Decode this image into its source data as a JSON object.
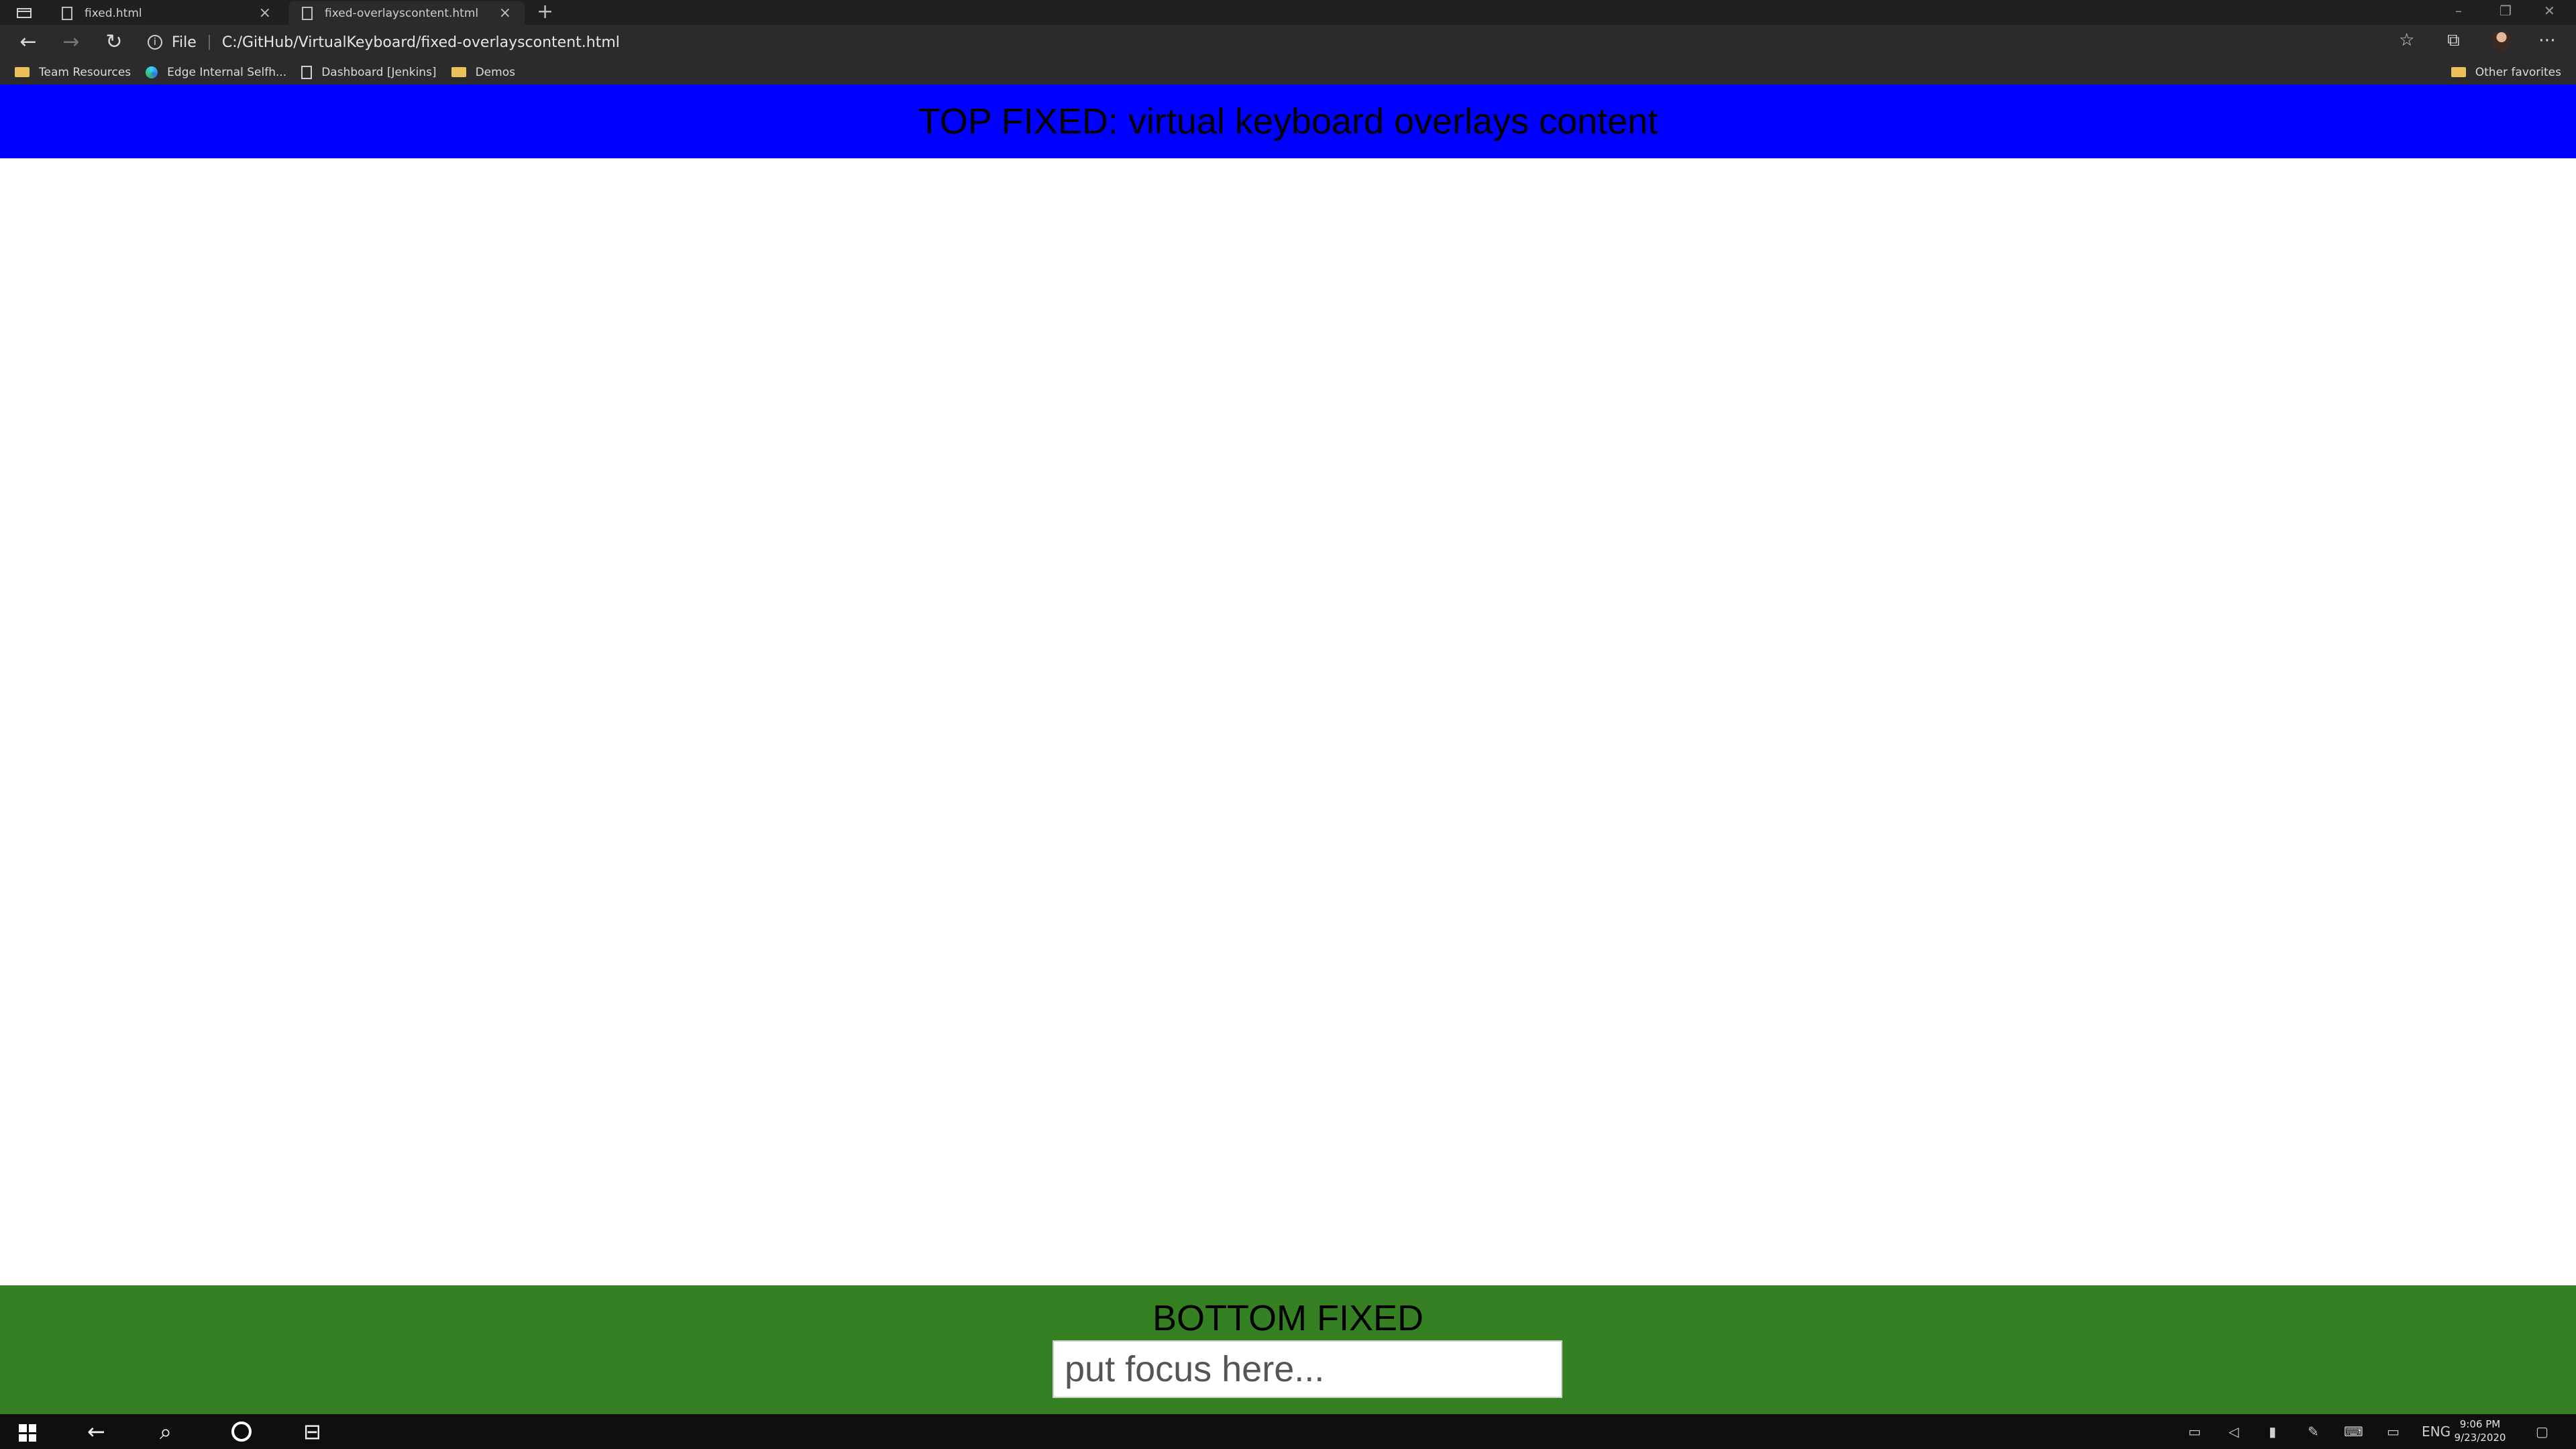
{
  "browser": {
    "tabs": [
      {
        "label": "fixed.html",
        "active": false
      },
      {
        "label": "fixed-overlayscontent.html",
        "active": true
      }
    ],
    "address": {
      "scheme_label": "File",
      "url": "C:/GitHub/VirtualKeyboard/fixed-overlayscontent.html"
    },
    "favorites": [
      {
        "label": "Team Resources",
        "icon": "folder-icon"
      },
      {
        "label": "Edge Internal Selfh...",
        "icon": "edge-icon"
      },
      {
        "label": "Dashboard [Jenkins]",
        "icon": "page-icon"
      },
      {
        "label": "Demos",
        "icon": "folder-icon"
      }
    ],
    "other_favorites": "Other favorites"
  },
  "page": {
    "top_fixed_text": "TOP FIXED: virtual keyboard overlays content",
    "top_fixed_color": "#0000ff",
    "bottom_fixed_text": "BOTTOM FIXED",
    "bottom_fixed_color": "#358023",
    "input_placeholder": "put focus here..."
  },
  "taskbar": {
    "language": "ENG",
    "time": "9:06 PM",
    "date": "9/23/2020"
  }
}
